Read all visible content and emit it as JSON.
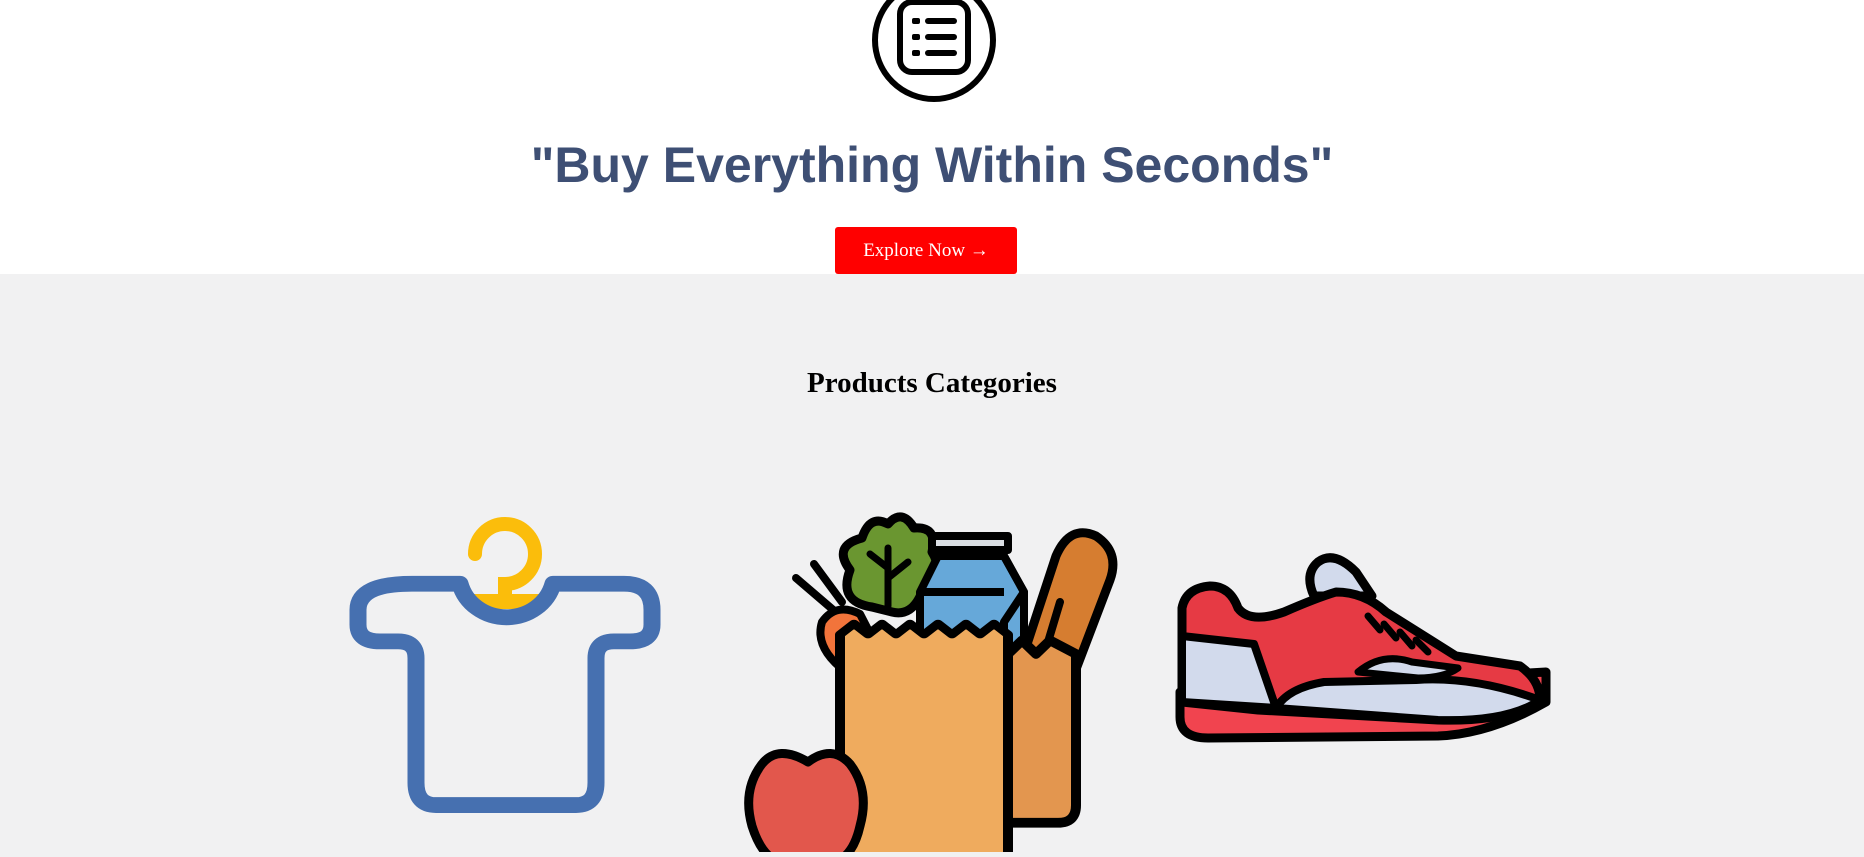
{
  "hero": {
    "icon": "list-document-icon",
    "title": "\"Buy Everything Within Seconds\"",
    "cta_label": "Explore Now →",
    "cta_color": "#ff0000",
    "title_color": "#3e4f74"
  },
  "categories": {
    "heading": "Products Categories",
    "background": "#f1f1f2",
    "items": [
      {
        "icon": "tshirt-hanger-icon"
      },
      {
        "icon": "grocery-bag-icon"
      },
      {
        "icon": "sneaker-icon"
      }
    ]
  }
}
